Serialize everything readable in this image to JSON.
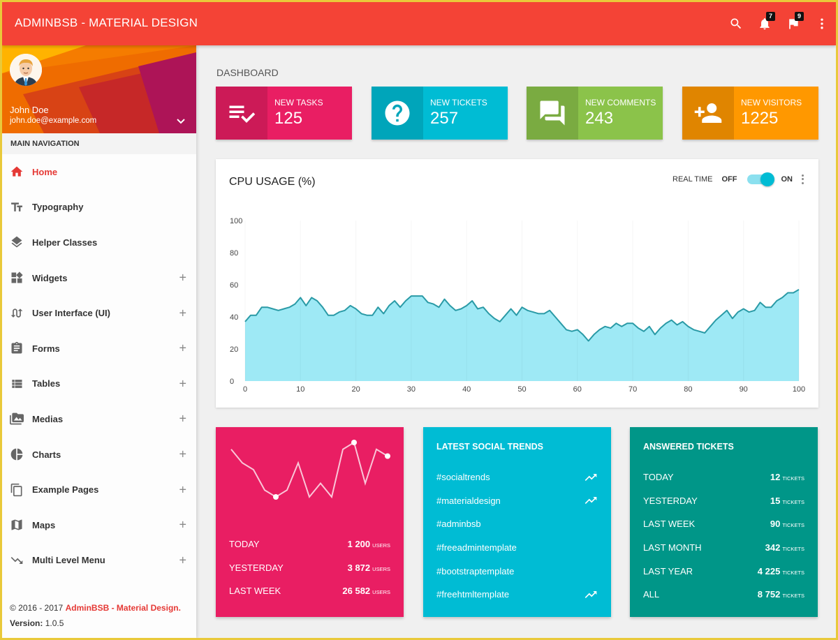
{
  "app": {
    "title": "ADMINBSB - MATERIAL DESIGN",
    "accent_color": "#f44336"
  },
  "topbar": {
    "icons": [
      {
        "name": "search-icon",
        "badge": null
      },
      {
        "name": "bell-icon",
        "badge": "7"
      },
      {
        "name": "flag-icon",
        "badge": "9"
      },
      {
        "name": "more-vert-icon",
        "badge": null
      }
    ]
  },
  "user": {
    "name": "John Doe",
    "email": "john.doe@example.com"
  },
  "sidebar": {
    "header": "MAIN NAVIGATION",
    "items": [
      {
        "label": "Home",
        "icon": "home-icon",
        "active": true,
        "expandable": false
      },
      {
        "label": "Typography",
        "icon": "text-fields-icon",
        "active": false,
        "expandable": false
      },
      {
        "label": "Helper Classes",
        "icon": "layers-icon",
        "active": false,
        "expandable": false
      },
      {
        "label": "Widgets",
        "icon": "widgets-icon",
        "active": false,
        "expandable": true
      },
      {
        "label": "User Interface (UI)",
        "icon": "swap-calls-icon",
        "active": false,
        "expandable": true
      },
      {
        "label": "Forms",
        "icon": "assignment-icon",
        "active": false,
        "expandable": true
      },
      {
        "label": "Tables",
        "icon": "view-list-icon",
        "active": false,
        "expandable": true
      },
      {
        "label": "Medias",
        "icon": "perm-media-icon",
        "active": false,
        "expandable": true
      },
      {
        "label": "Charts",
        "icon": "pie-chart-icon",
        "active": false,
        "expandable": true
      },
      {
        "label": "Example Pages",
        "icon": "content-copy-icon",
        "active": false,
        "expandable": true
      },
      {
        "label": "Maps",
        "icon": "map-icon",
        "active": false,
        "expandable": true
      },
      {
        "label": "Multi Level Menu",
        "icon": "trending-down-icon",
        "active": false,
        "expandable": true
      }
    ],
    "expand_symbol": "+",
    "footer": {
      "copyright_prefix": "© 2016 - 2017 ",
      "copyright_link": "AdminBSB - Material Design.",
      "version_label": "Version: ",
      "version": "1.0.5"
    }
  },
  "page": {
    "title": "DASHBOARD"
  },
  "info_boxes": [
    {
      "label": "NEW TASKS",
      "value": "125",
      "icon": "playlist-check-icon",
      "color": "#e91e63"
    },
    {
      "label": "NEW TICKETS",
      "value": "257",
      "icon": "help-icon",
      "color": "#00bcd4"
    },
    {
      "label": "NEW COMMENTS",
      "value": "243",
      "icon": "forum-icon",
      "color": "#8bc34a"
    },
    {
      "label": "NEW VISITORS",
      "value": "1225",
      "icon": "person-add-icon",
      "color": "#ff9800"
    }
  ],
  "cpu_card": {
    "title": "CPU USAGE (%)",
    "realtime_label": "REAL TIME",
    "off_label": "OFF",
    "on_label": "ON",
    "realtime_on": true
  },
  "chart_data": [
    {
      "type": "area",
      "title": "CPU USAGE (%)",
      "xlabel": "",
      "ylabel": "",
      "xlim": [
        0,
        100
      ],
      "ylim": [
        0,
        100
      ],
      "xticks": [
        0,
        10,
        20,
        30,
        40,
        50,
        60,
        70,
        80,
        90,
        100
      ],
      "yticks": [
        0,
        20,
        40,
        60,
        80,
        100
      ],
      "grid": "vertical",
      "series": [
        {
          "name": "CPU",
          "color": "#00bcd4",
          "x": [
            0,
            1,
            2,
            3,
            4,
            5,
            6,
            7,
            8,
            9,
            10,
            11,
            12,
            13,
            14,
            15,
            16,
            17,
            18,
            19,
            20,
            21,
            22,
            23,
            24,
            25,
            26,
            27,
            28,
            29,
            30,
            31,
            32,
            33,
            34,
            35,
            36,
            37,
            38,
            39,
            40,
            41,
            42,
            43,
            44,
            45,
            46,
            47,
            48,
            49,
            50,
            51,
            52,
            53,
            54,
            55,
            56,
            57,
            58,
            59,
            60,
            61,
            62,
            63,
            64,
            65,
            66,
            67,
            68,
            69,
            70,
            71,
            72,
            73,
            74,
            75,
            76,
            77,
            78,
            79,
            80,
            81,
            82,
            83,
            84,
            85,
            86,
            87,
            88,
            89,
            90,
            91,
            92,
            93,
            94,
            95,
            96,
            97,
            98,
            99,
            100
          ],
          "values": [
            37,
            41,
            41,
            46,
            46,
            45,
            44,
            45,
            46,
            48,
            52,
            47,
            52,
            50,
            46,
            41,
            41,
            43,
            44,
            47,
            45,
            42,
            41,
            41,
            46,
            42,
            47,
            50,
            46,
            50,
            53,
            53,
            53,
            49,
            48,
            46,
            51,
            47,
            44,
            45,
            47,
            50,
            45,
            46,
            42,
            39,
            37,
            41,
            45,
            41,
            46,
            44,
            43,
            42,
            42,
            44,
            40,
            36,
            32,
            31,
            32,
            29,
            25,
            29,
            32,
            34,
            33,
            36,
            34,
            36,
            36,
            33,
            31,
            34,
            29,
            33,
            36,
            38,
            35,
            37,
            34,
            32,
            31,
            30,
            34,
            38,
            41,
            44,
            39,
            43,
            45,
            43,
            44,
            49,
            46,
            46,
            50,
            52,
            55,
            55,
            57
          ]
        }
      ]
    },
    {
      "type": "line",
      "title": "",
      "series": [
        {
          "name": "users",
          "color": "#ffffff",
          "values": [
            8,
            6,
            5,
            2,
            1,
            2,
            6,
            1,
            3,
            1,
            8,
            9,
            3,
            8,
            7
          ],
          "highlighted_points": [
            4,
            11,
            14
          ]
        }
      ]
    }
  ],
  "users_card": {
    "stats": [
      {
        "label": "TODAY",
        "value": "1 200",
        "unit": "USERS"
      },
      {
        "label": "YESTERDAY",
        "value": "3 872",
        "unit": "USERS"
      },
      {
        "label": "LAST WEEK",
        "value": "26 582",
        "unit": "USERS"
      }
    ]
  },
  "social_card": {
    "title": "LATEST SOCIAL TRENDS",
    "items": [
      {
        "tag": "#socialtrends",
        "trending": true
      },
      {
        "tag": "#materialdesign",
        "trending": true
      },
      {
        "tag": "#adminbsb",
        "trending": false
      },
      {
        "tag": "#freeadmintemplate",
        "trending": false
      },
      {
        "tag": "#bootstraptemplate",
        "trending": false
      },
      {
        "tag": "#freehtmltemplate",
        "trending": true
      }
    ]
  },
  "tickets_card": {
    "title": "ANSWERED TICKETS",
    "stats": [
      {
        "label": "TODAY",
        "value": "12",
        "unit": "TICKETS"
      },
      {
        "label": "YESTERDAY",
        "value": "15",
        "unit": "TICKETS"
      },
      {
        "label": "LAST WEEK",
        "value": "90",
        "unit": "TICKETS"
      },
      {
        "label": "LAST MONTH",
        "value": "342",
        "unit": "TICKETS"
      },
      {
        "label": "LAST YEAR",
        "value": "4 225",
        "unit": "TICKETS"
      },
      {
        "label": "ALL",
        "value": "8 752",
        "unit": "TICKETS"
      }
    ]
  }
}
